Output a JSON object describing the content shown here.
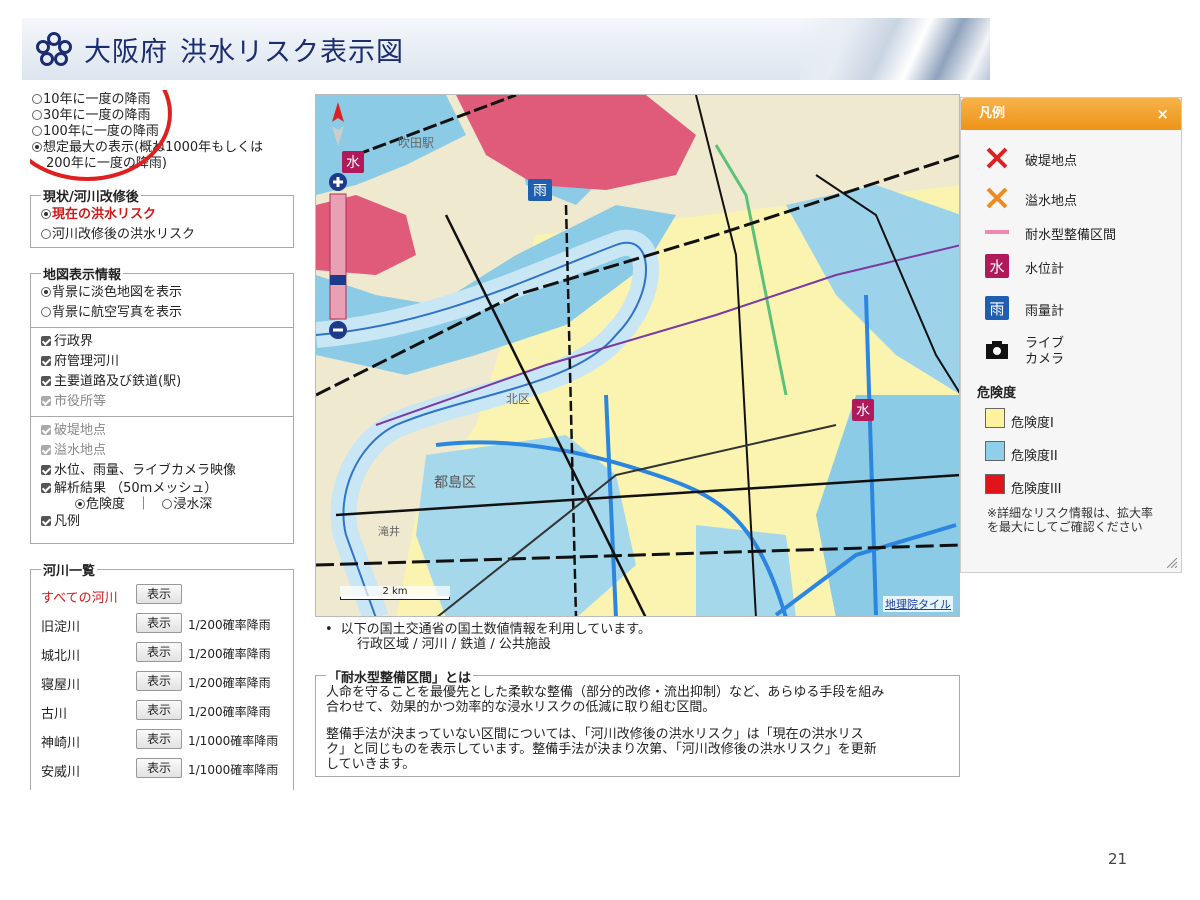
{
  "header": {
    "title_main": "大阪府",
    "title_sub": "洪水リスク表示図"
  },
  "rain_options": [
    {
      "label": "10年に一度の降雨",
      "selected": false
    },
    {
      "label": "30年に一度の降雨",
      "selected": false
    },
    {
      "label": "100年に一度の降雨",
      "selected": false
    },
    {
      "label": "想定最大の表示(概ね1000年もしくは",
      "label2": "200年に一度の降雨)",
      "selected": true
    }
  ],
  "status_group": {
    "legend": "現状/河川改修後",
    "options": [
      {
        "label": "現在の洪水リスク",
        "selected": true
      },
      {
        "label": "河川改修後の洪水リスク",
        "selected": false
      }
    ]
  },
  "map_info": {
    "legend": "地図表示情報",
    "background_options": [
      {
        "label": "背景に淡色地図を表示",
        "selected": true
      },
      {
        "label": "背景に航空写真を表示",
        "selected": false
      }
    ],
    "layers": [
      {
        "label": "行政界",
        "checked": true,
        "enabled": true
      },
      {
        "label": "府管理河川",
        "checked": true,
        "enabled": true
      },
      {
        "label": "主要道路及び鉄道(駅)",
        "checked": true,
        "enabled": true
      },
      {
        "label": "市役所等",
        "checked": true,
        "enabled": false
      }
    ],
    "overlays": [
      {
        "label": "破堤地点",
        "checked": true,
        "enabled": false
      },
      {
        "label": "溢水地点",
        "checked": true,
        "enabled": false
      },
      {
        "label": "水位、雨量、ライブカメラ映像",
        "checked": true,
        "enabled": true
      },
      {
        "label": "解析結果 （50mメッシュ）",
        "checked": true,
        "enabled": true
      }
    ],
    "analysis_options": {
      "danger": "危険度",
      "separator": "｜",
      "depth": "浸水深"
    },
    "legend_toggle": "凡例"
  },
  "river_list": {
    "legend": "河川一覧",
    "all_label": "すべての河川",
    "show_label": "表示",
    "rivers": [
      {
        "name": "旧淀川",
        "prob": "1/200確率降雨"
      },
      {
        "name": "城北川",
        "prob": "1/200確率降雨"
      },
      {
        "name": "寝屋川",
        "prob": "1/200確率降雨"
      },
      {
        "name": "古川",
        "prob": "1/200確率降雨"
      },
      {
        "name": "神崎川",
        "prob": "1/1000確率降雨"
      },
      {
        "name": "安威川",
        "prob": "1/1000確率降雨"
      }
    ]
  },
  "map": {
    "scale_label": "2 km",
    "credit": "地理院タイル",
    "place_labels": [
      "吹田駅",
      "都島区",
      "北区",
      "滝井"
    ],
    "gauge_badges": {
      "water": "水",
      "rain": "雨"
    }
  },
  "legend_panel": {
    "title": "凡例",
    "close": "×",
    "items": [
      {
        "label": "破堤地点",
        "icon": "red-x-icon"
      },
      {
        "label": "溢水地点",
        "icon": "orange-x-icon"
      },
      {
        "label": "耐水型整備区間",
        "icon": "pink-line-icon"
      },
      {
        "label": "水位計",
        "icon": "water-gauge-icon"
      },
      {
        "label": "雨量計",
        "icon": "rain-gauge-icon"
      },
      {
        "label": "ライブ",
        "label2": "カメラ",
        "icon": "camera-icon"
      }
    ],
    "danger_title": "危険度",
    "danger_levels": [
      {
        "label": "危険度I",
        "color": "#fff3a0"
      },
      {
        "label": "危険度II",
        "color": "#8fcfea"
      },
      {
        "label": "危険度III",
        "color": "#e0141b"
      }
    ],
    "note": "※詳細なリスク情報は、拡大率を最大にしてご確認ください"
  },
  "data_source": {
    "line1": "以下の国土交通省の国土数値情報を利用しています。",
    "line2": "行政区域 / 河川 / 鉄道 / 公共施設"
  },
  "info_box": {
    "title": "「耐水型整備区間」とは",
    "para1_l1": "人命を守ることを最優先とした柔軟な整備（部分的改修・流出抑制）など、あらゆる手段を組み",
    "para1_l2": "合わせて、効果的かつ効率的な浸水リスクの低減に取り組む区間。",
    "para2_l1": "整備手法が決まっていない区間については、「河川改修後の洪水リスク」は「現在の洪水リス",
    "para2_l2": "ク」と同じものを表示しています。整備手法が決まり次第、「河川改修後の洪水リスク」を更新",
    "para2_l3": "していきます。"
  },
  "page_number": "21"
}
